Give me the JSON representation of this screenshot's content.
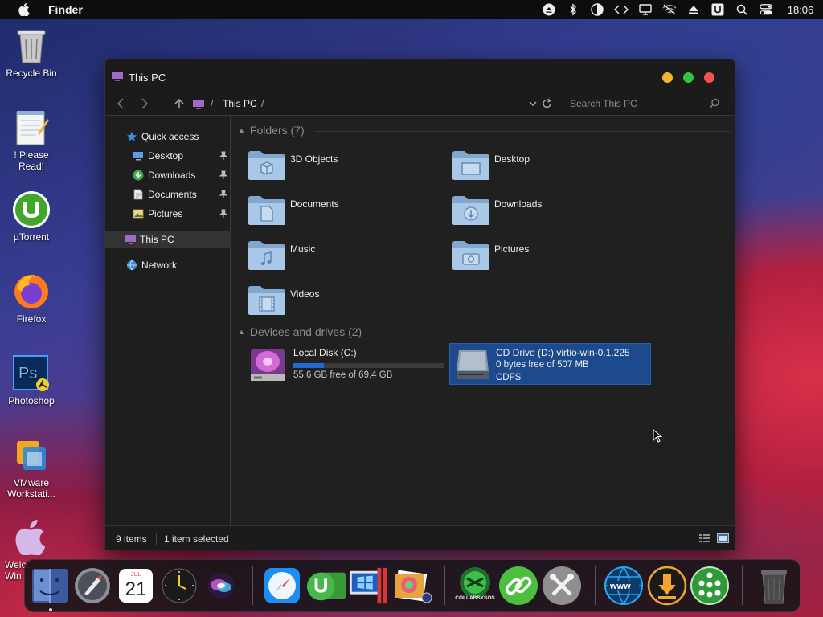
{
  "menubar": {
    "app_name": "Finder",
    "clock": "18:06",
    "status_icons": [
      "eject-icon",
      "bluetooth-icon",
      "half-moon-icon",
      "code-icon",
      "display-icon",
      "wifi-off-icon",
      "upload-icon",
      "u-icon",
      "search-icon",
      "control-center-icon"
    ]
  },
  "desktop": {
    "icons": [
      {
        "label": "Recycle Bin",
        "icon": "recycle-bin-icon"
      },
      {
        "label": "! Please Read!",
        "icon": "notepad-icon"
      },
      {
        "label": "µTorrent",
        "icon": "utorrent-icon"
      },
      {
        "label": "Firefox",
        "icon": "firefox-icon"
      },
      {
        "label": "Photoshop",
        "icon": "photoshop-icon"
      },
      {
        "label": "VMware Workstati...",
        "icon": "vmware-icon"
      }
    ],
    "partial_label": "Welco Win"
  },
  "window": {
    "title": "This PC",
    "address": {
      "crumb": "This PC",
      "separator": "/",
      "search_placeholder": "Search This PC"
    },
    "sidebar": {
      "items": [
        {
          "label": "Quick access",
          "icon": "star-icon",
          "pinned": false
        },
        {
          "label": "Desktop",
          "icon": "desktop-icon",
          "pinned": true
        },
        {
          "label": "Downloads",
          "icon": "downloads-icon",
          "pinned": true
        },
        {
          "label": "Documents",
          "icon": "documents-icon",
          "pinned": true
        },
        {
          "label": "Pictures",
          "icon": "pictures-icon",
          "pinned": true
        },
        {
          "label": "This PC",
          "icon": "this-pc-icon",
          "selected": true
        },
        {
          "label": "Network",
          "icon": "network-icon"
        }
      ]
    },
    "folders_group": {
      "title": "Folders (7)",
      "items": [
        {
          "label": "3D Objects",
          "icon": "3d-objects-folder-icon"
        },
        {
          "label": "Desktop",
          "icon": "desktop-folder-icon"
        },
        {
          "label": "Documents",
          "icon": "documents-folder-icon"
        },
        {
          "label": "Downloads",
          "icon": "downloads-folder-icon"
        },
        {
          "label": "Music",
          "icon": "music-folder-icon"
        },
        {
          "label": "Pictures",
          "icon": "pictures-folder-icon"
        },
        {
          "label": "Videos",
          "icon": "videos-folder-icon"
        }
      ]
    },
    "drives_group": {
      "title": "Devices and drives (2)",
      "local_disk": {
        "label": "Local Disk (C:)",
        "free_text": "55.6 GB free of 69.4 GB",
        "used_fraction": 0.2
      },
      "cd_drive": {
        "label": "CD Drive (D:) virtio-win-0.1.225",
        "free_text": "0 bytes free of 507 MB",
        "filesystem": "CDFS"
      }
    },
    "status": {
      "item_count": "9 items",
      "selection": "1 item selected"
    }
  },
  "dock": {
    "calendar_month": "JUL",
    "calendar_day": "21",
    "items": [
      "finder-icon",
      "launchpad-icon",
      "calendar-icon",
      "clock-icon",
      "siri-icon",
      "safari-icon",
      "utorrent-icon",
      "windows-icon",
      "photos-icon",
      "collabsysos-icon",
      "link-icon",
      "tools-icon",
      "www-icon",
      "download-icon",
      "network-people-icon",
      "trash-icon"
    ],
    "collabsysos_label": "COLLABSYSOS"
  },
  "colors": {
    "accent": "#2567d6",
    "selection": "#1d4a8d",
    "window_bg": "#202020"
  }
}
